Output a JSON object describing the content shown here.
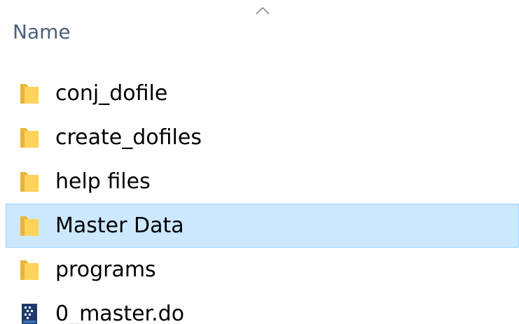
{
  "header": {
    "column_name": "Name",
    "sort_icon": "chevron-up-icon"
  },
  "colors": {
    "selection_bg": "#cce8ff",
    "selection_border": "#99d1ff",
    "folder_yellow": "#ffd258",
    "header_text": "#4c607a"
  },
  "files": [
    {
      "name": "conj_dofile",
      "icon": "folder-icon",
      "selected": false
    },
    {
      "name": "create_dofiles",
      "icon": "folder-icon",
      "selected": false
    },
    {
      "name": "help files",
      "icon": "folder-icon",
      "selected": false
    },
    {
      "name": "Master Data",
      "icon": "folder-icon",
      "selected": true
    },
    {
      "name": "programs",
      "icon": "folder-icon",
      "selected": false
    },
    {
      "name": "0_master.do",
      "icon": "stata-do-file-icon",
      "selected": false
    }
  ]
}
